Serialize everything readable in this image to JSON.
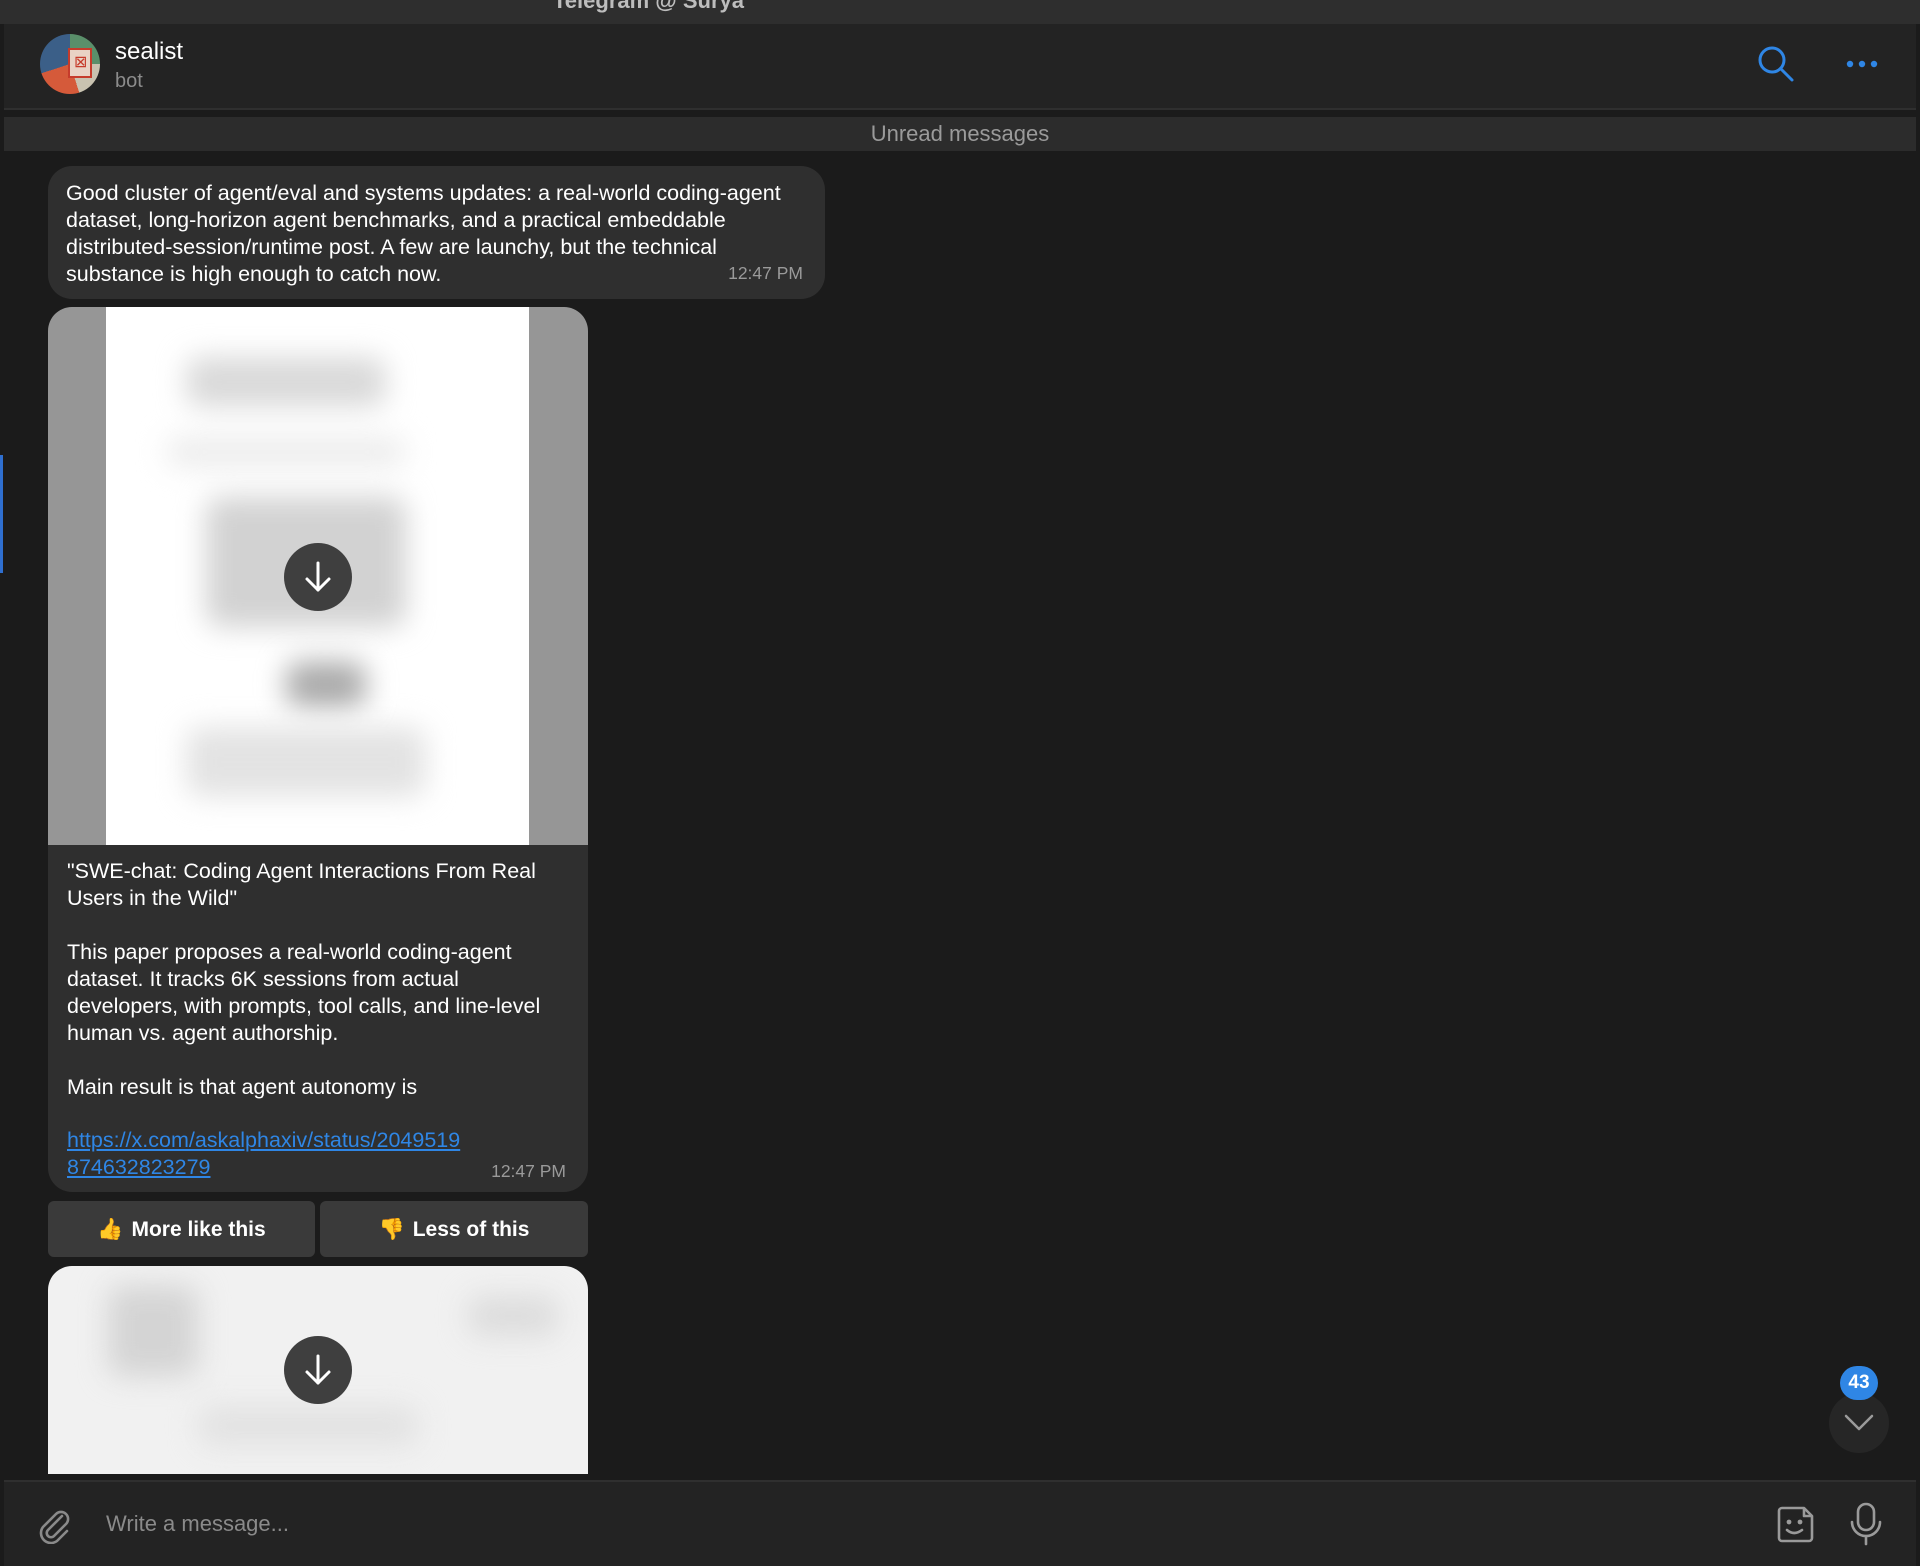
{
  "window": {
    "title": "Telegram @ Surya"
  },
  "chat": {
    "name": "sealist",
    "status": "bot"
  },
  "header_icons": {
    "search": "search-icon",
    "more": "more-icon"
  },
  "unread_label": "Unread messages",
  "messages": [
    {
      "text": "Good cluster of agent/eval and systems updates: a real-world coding-agent dataset, long-horizon agent benchmarks, and a practical embeddable distributed-session/runtime post. A few are launchy, but the technical substance is high enough to catch now.",
      "time": "12:47 PM"
    },
    {
      "title": "\"SWE-chat: Coding Agent Interactions From Real Users in the Wild\"",
      "body": "This paper proposes a real-world coding-agent dataset. It tracks 6K sessions from actual developers, with prompts, tool calls, and line-level human vs. agent authorship.",
      "summary": "Main result is that agent autonomy is",
      "link": "https://x.com/askalphaxiv/status/2049519874632823279",
      "time": "12:47 PM"
    }
  ],
  "keyboard": {
    "more": "More like this",
    "less": "Less of this",
    "more_emoji": "👍",
    "less_emoji": "👎"
  },
  "unread_count": "43",
  "composer": {
    "placeholder": "Write a message..."
  },
  "colors": {
    "accent": "#2f86e5",
    "bubble": "#2f2f2f",
    "background": "#1b1b1b"
  }
}
